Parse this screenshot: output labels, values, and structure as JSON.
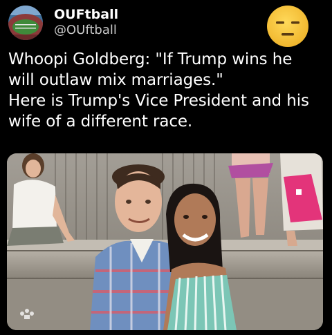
{
  "account": {
    "display_name": "OUFtball",
    "handle": "@OUftball",
    "avatar_icon": "stadium-avatar",
    "reaction_icon": "expressionless-face-emoji"
  },
  "tweet": {
    "lines": [
      "Whoopi Goldberg: \"If Trump wins he",
      "will outlaw mix marriages.\"",
      "Here is Trump's Vice President and his",
      "wife of a different race."
    ]
  },
  "photo": {
    "subject": "couple-photo",
    "watermark_icon": "network-peacock-logo"
  },
  "colors": {
    "background": "#000000",
    "text": "#ffffff",
    "handle": "#c8c8c8",
    "emoji": "#f6c33b"
  }
}
